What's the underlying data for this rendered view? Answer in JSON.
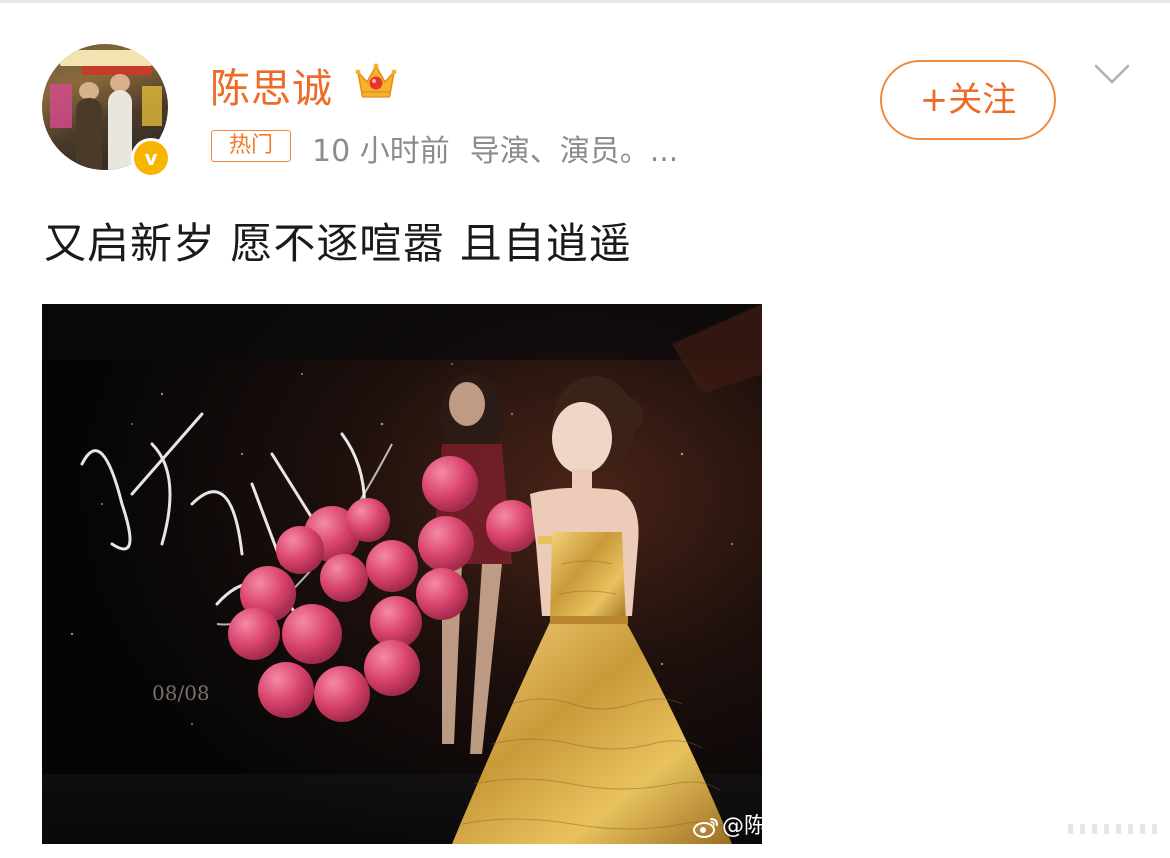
{
  "header": {
    "user_name": "陈思诚",
    "hot_tag": "热门",
    "time": "10 小时前",
    "bio": "导演、演员。...",
    "follow_label": "+关注",
    "verified_badge": "v"
  },
  "post": {
    "text": "又启新岁 愿不逐喧嚣 且自逍遥",
    "image": {
      "description_icon": "photo",
      "watermark": "@陈",
      "background_signature": "生日快乐",
      "background_date": "08/08"
    }
  },
  "colors": {
    "accent": "#ed6b27",
    "verified": "#f8b500",
    "meta_text": "#8c8c8c"
  },
  "icons": [
    "crown-icon",
    "verified-badge-icon",
    "chevron-down-icon",
    "weibo-icon"
  ]
}
